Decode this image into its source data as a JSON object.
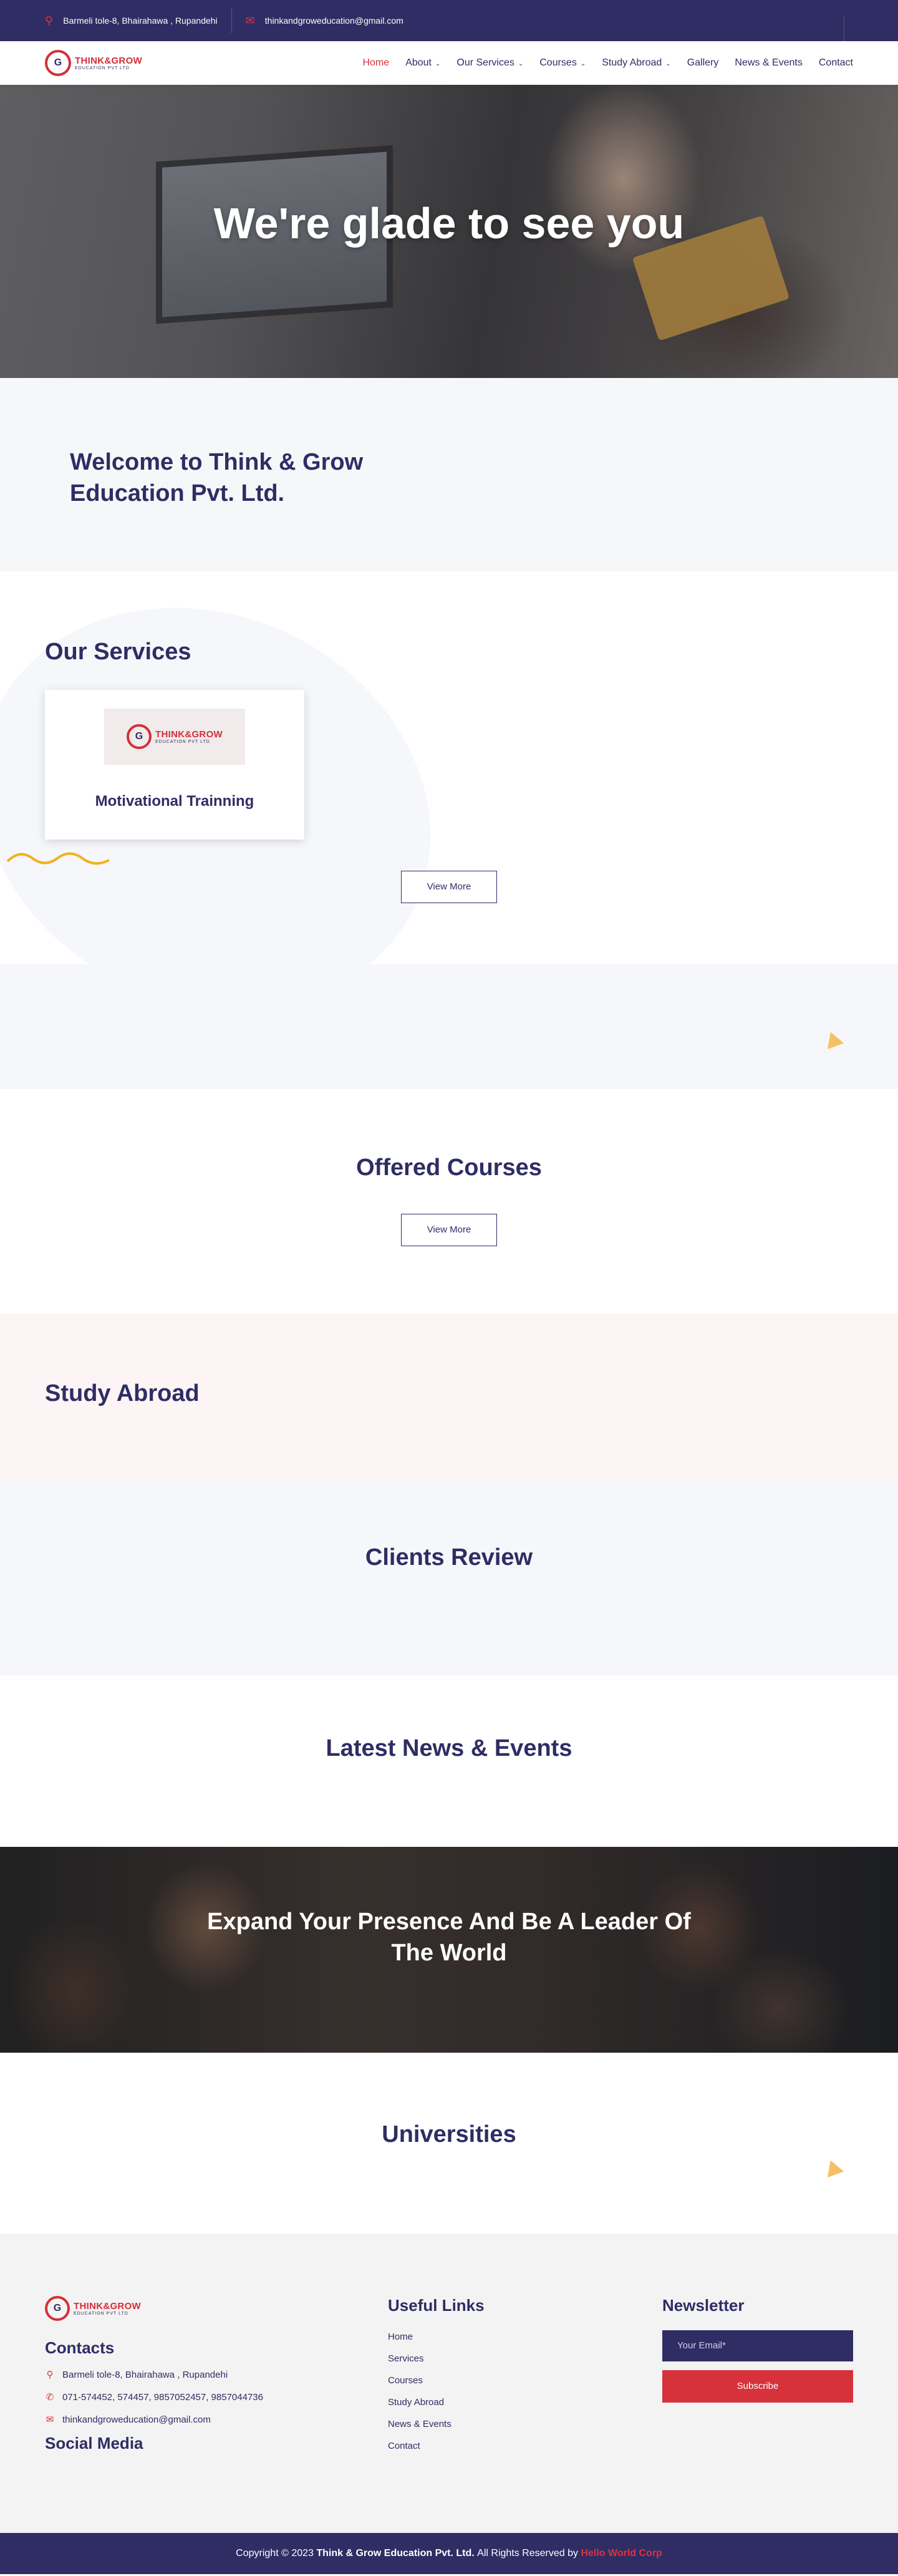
{
  "topbar": {
    "address": "Barmeli tole-8, Bhairahawa , Rupandehi",
    "email": "thinkandgroweducation@gmail.com"
  },
  "logo": {
    "mark": "G",
    "name_part1": "THINK&",
    "name_part2": "GROW",
    "sub": "EDUCATION PVT LTD"
  },
  "nav": {
    "items": [
      {
        "label": "Home",
        "active": true,
        "dropdown": false
      },
      {
        "label": "About",
        "dropdown": true
      },
      {
        "label": "Our Services",
        "dropdown": true
      },
      {
        "label": "Courses",
        "dropdown": true
      },
      {
        "label": "Study Abroad",
        "dropdown": true
      },
      {
        "label": "Gallery",
        "dropdown": false
      },
      {
        "label": "News & Events",
        "dropdown": false
      },
      {
        "label": "Contact",
        "dropdown": false
      }
    ]
  },
  "hero": {
    "title": "We're glade to see you"
  },
  "welcome": {
    "title": "Welcome to Think & Grow Education Pvt. Ltd."
  },
  "services": {
    "title": "Our Services",
    "cards": [
      {
        "title": "Motivational Trainning"
      }
    ],
    "view_more": "View More"
  },
  "courses": {
    "title": "Offered Courses",
    "view_more": "View More"
  },
  "abroad": {
    "title": "Study Abroad"
  },
  "reviews": {
    "title": "Clients Review"
  },
  "news": {
    "title": "Latest News & Events"
  },
  "cta": {
    "title": "Expand Your Presence And Be A Leader Of The World"
  },
  "universities": {
    "title": "Universities"
  },
  "footer": {
    "contacts_title": "Contacts",
    "address": "Barmeli tole-8, Bhairahawa , Rupandehi",
    "phone": "071-574452, 574457, 9857052457, 9857044736",
    "email": "thinkandgroweducation@gmail.com",
    "social_title": "Social Media",
    "links_title": "Useful Links",
    "links": [
      "Home",
      "Services",
      "Courses",
      "Study Abroad",
      "News & Events",
      "Contact"
    ],
    "newsletter_title": "Newsletter",
    "email_placeholder": "Your Email*",
    "subscribe": "Subscribe"
  },
  "copyright": {
    "prefix": "Copyright © 2023",
    "company": "Think & Grow Education Pvt. Ltd.",
    "middle": "All Rights Reserved by",
    "developer": "Hello World Corp"
  },
  "colors": {
    "primary": "#2f2d64",
    "accent": "#e0313c",
    "accent_yellow": "#f5c065"
  },
  "icons": [
    "location-icon",
    "mail-icon",
    "phone-icon",
    "chevron-down-icon"
  ]
}
